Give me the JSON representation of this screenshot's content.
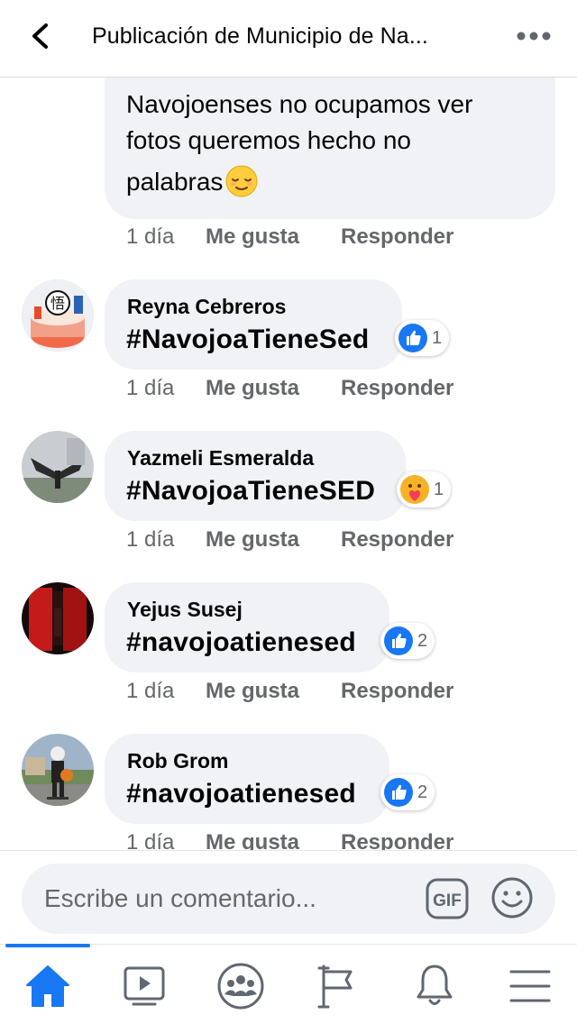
{
  "header": {
    "title": "Publicación de Municipio de Na...",
    "back_icon": "chevron-left-icon",
    "more_icon": "more-horizontal-icon"
  },
  "first_comment": {
    "line1": "Navojoenses  no ocupamos ver",
    "line2": "fotos queremos hecho no",
    "line3": "palabras",
    "emoji": "relieved-face-emoji",
    "time": "1 día",
    "like_label": "Me gusta",
    "reply_label": "Responder"
  },
  "comments": [
    {
      "author": "Reyna Cebreros",
      "text": "#NavojoaTieneSed",
      "reaction": "like",
      "reaction_count": "1",
      "time": "1 día",
      "like_label": "Me gusta",
      "reply_label": "Responder"
    },
    {
      "author": "Yazmeli Esmeralda",
      "text": "#NavojoaTieneSED",
      "reaction": "care",
      "reaction_count": "1",
      "time": "1 día",
      "like_label": "Me gusta",
      "reply_label": "Responder"
    },
    {
      "author": "Yejus Susej",
      "text": "#navojoatienesed",
      "reaction": "like",
      "reaction_count": "2",
      "time": "1 día",
      "like_label": "Me gusta",
      "reply_label": "Responder"
    },
    {
      "author": "Rob Grom",
      "text": "#navojoatienesed",
      "reaction": "like",
      "reaction_count": "2",
      "time": "1 día",
      "like_label": "Me gusta",
      "reply_label": "Responder"
    }
  ],
  "composer": {
    "placeholder": "Escribe un comentario...",
    "gif_label": "GIF",
    "emoji_icon": "smiley-icon"
  },
  "nav": {
    "active": "home",
    "items": [
      "home-icon",
      "video-icon",
      "groups-icon",
      "pages-flag-icon",
      "bell-icon",
      "menu-icon"
    ]
  },
  "colors": {
    "accent": "#1877f2",
    "bubble": "#f0f2f5",
    "secondary_text": "#65676b",
    "icon_gray": "#606770"
  }
}
